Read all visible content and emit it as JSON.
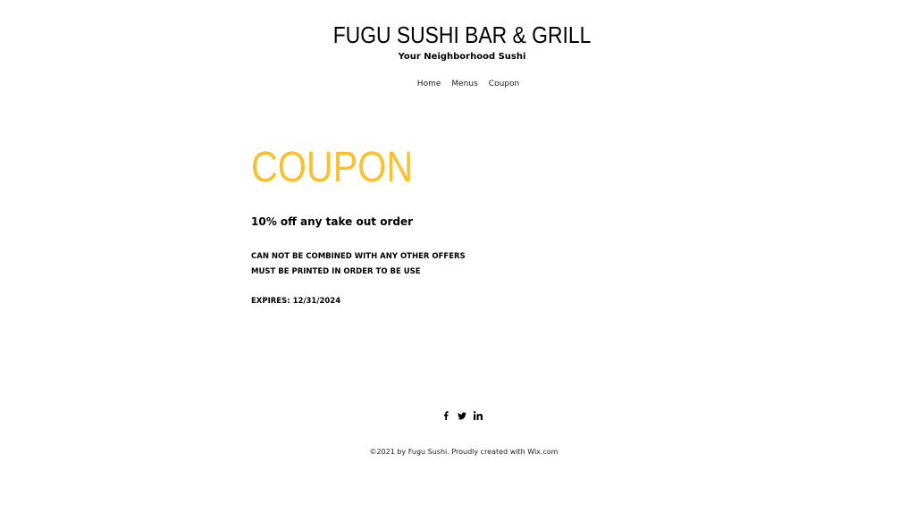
{
  "header": {
    "title": "FUGU SUSHI BAR & GRILL",
    "tagline": "Your Neighborhood Sushi"
  },
  "nav": {
    "items": [
      {
        "label": "Home"
      },
      {
        "label": "Menus"
      },
      {
        "label": "Coupon"
      }
    ]
  },
  "main": {
    "heading": "COUPON",
    "offer": "10% off any take out order",
    "terms": [
      "CAN NOT BE COMBINED WITH ANY OTHER OFFERS",
      "MUST BE PRINTED IN ORDER TO BE USE"
    ],
    "expires": "EXPIRES: 12/31/2024"
  },
  "footer": {
    "social": [
      {
        "icon": "facebook-icon"
      },
      {
        "icon": "twitter-icon"
      },
      {
        "icon": "linkedin-icon"
      }
    ],
    "copyright": "©2021 by Fugu Sushi. Proudly created with Wix.com"
  },
  "colors": {
    "accent": "#f9c12f",
    "text": "#000000",
    "background": "#ffffff"
  }
}
